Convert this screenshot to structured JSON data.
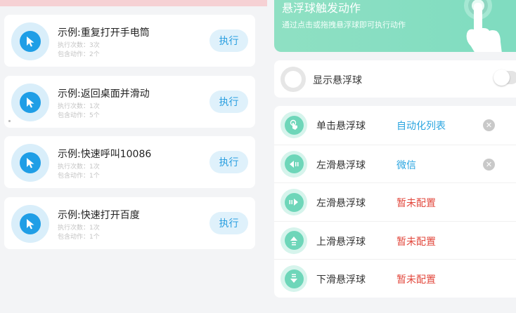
{
  "tasks": [
    {
      "title": "示例:重复打开手电筒",
      "exec_count": "执行次数：3次",
      "action_count": "包含动作：2个",
      "run_label": "执行"
    },
    {
      "title": "示例:返回桌面并滑动",
      "exec_count": "执行次数：1次",
      "action_count": "包含动作：5个",
      "run_label": "执行"
    },
    {
      "title": "示例:快速呼叫10086",
      "exec_count": "执行次数：1次",
      "action_count": "包含动作：1个",
      "run_label": "执行"
    },
    {
      "title": "示例:快速打开百度",
      "exec_count": "执行次数：1次",
      "action_count": "包含动作：1个",
      "run_label": "执行"
    }
  ],
  "banner": {
    "title": "悬浮球触发动作",
    "subtitle": "通过点击或拖拽悬浮球即可执行动作"
  },
  "toggle": {
    "label": "显示悬浮球",
    "enabled": false
  },
  "actions": [
    {
      "name": "单击悬浮球",
      "target": "自动化列表",
      "configured": true,
      "icon": "tap-icon"
    },
    {
      "name": "左滑悬浮球",
      "target": "微信",
      "configured": true,
      "icon": "swipe-left-icon"
    },
    {
      "name": "左滑悬浮球",
      "target": "暂未配置",
      "configured": false,
      "icon": "swipe-right-icon"
    },
    {
      "name": "上滑悬浮球",
      "target": "暂未配置",
      "configured": false,
      "icon": "swipe-up-icon"
    },
    {
      "name": "下滑悬浮球",
      "target": "暂未配置",
      "configured": false,
      "icon": "swipe-down-icon"
    }
  ],
  "colors": {
    "primary_blue": "#1f9ee6",
    "mint": "#6ed6b9",
    "unset_red": "#e2483d"
  }
}
